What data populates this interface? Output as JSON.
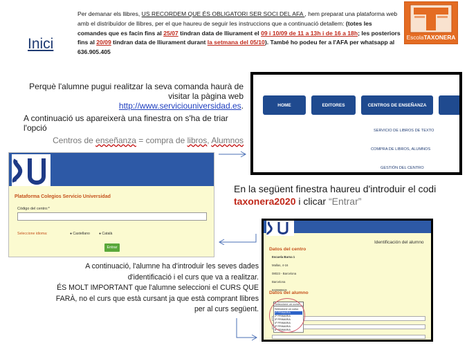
{
  "title": "Inici",
  "intro": {
    "t1": "Per demanar els llibres, ",
    "t2": "US RECORDEM QUE ÉS OBLIGATORI SER SOCI DEL AFA ",
    "t3": ", hem preparat una plataforma web amb el distribuïdor de llibres, per el que haureu de seguir les instruccions que a continuació detallem: ",
    "t4": "(totes les comandes que es facin fins al ",
    "t5": "25/07",
    "t6": " tindran data de lliurament el ",
    "t7": "09 i 10/09 de 11 a 13h i de 16 a 18h",
    "t8": "; les posteriors fins al ",
    "t9": "20/09",
    "t10": " tindran data de lliurament durant ",
    "t11": "la setmana del 05/10",
    "t12": "). També ho podeu fer a l'AFA per whatsapp al 636.905.405"
  },
  "logo": {
    "letter": "T",
    "prefix": "Escola",
    "name": "TAXONERA",
    "color": "#e46c23"
  },
  "step1": {
    "text": "Perquè l'alumne pugui realitzar la seva comanda haurà de visitar la pàgina web",
    "link": "http://www.serviciouniversidad.es",
    "after": "."
  },
  "step2": {
    "text": "A continuació us apareixerà una finestra on s'ha de triar l'opció"
  },
  "step3": {
    "t1": "Centros de ",
    "t2": "enseñanza",
    "t3": " = compra de ",
    "t4": "libros",
    "t5": ", ",
    "t6": "Alumnos"
  },
  "menu_shot": {
    "buttons": [
      "HOME",
      "EDITORES",
      "CENTROS DE ENSEÑANZA"
    ],
    "items": [
      "SERVICIO DE LIBROS DE TEXTO",
      "COMPRA DE LIBROS, ALUMNOS",
      "GESTIÓN DEL CENTRO"
    ],
    "accent": "#1f4a8f"
  },
  "login_shot": {
    "logo": "SU",
    "title": "Plataforma Colegios Servicio Universidad",
    "code_label": "Código del centro:*",
    "lang_label": "Seleccione idioma:",
    "lang_options": [
      "Castellano",
      "Català"
    ],
    "button": "Entrar"
  },
  "step4": {
    "t1": "En la següent finestra haureu d'introduir el codi ",
    "code": "taxonera2020",
    "t2": " i clicar ",
    "btn": "“Entrar”"
  },
  "form_shot": {
    "header": "Identificación del alumno",
    "section1": "Datos del centro",
    "center_lines": [
      "Escuela Barna 1",
      "Mallas, 4-16",
      "08023 - Barcelona",
      "Barcelona",
      "932999919"
    ],
    "section2": "Datos del alumno",
    "select_value": "Seleccione un curso",
    "options": [
      "Seleccione un curso",
      "1º PRIMARIA",
      "2º PRIMARIA",
      "3º PRIMARIA",
      "4º PRIMARIA",
      "5º PRIMARIA",
      "6º PRIMARIA"
    ]
  },
  "step5": {
    "l1": "A continuació, l'alumne ha d'introduir les seves dades",
    "l2": "d'identificació i el curs que va a realitzar.",
    "l3": "ÉS MOLT IMPORTANT que l'alumne seleccioni el CURS QUE",
    "l4": "FARÀ, no el curs que està cursant ja que està comprant llibres",
    "l5": "per al curs següent."
  }
}
